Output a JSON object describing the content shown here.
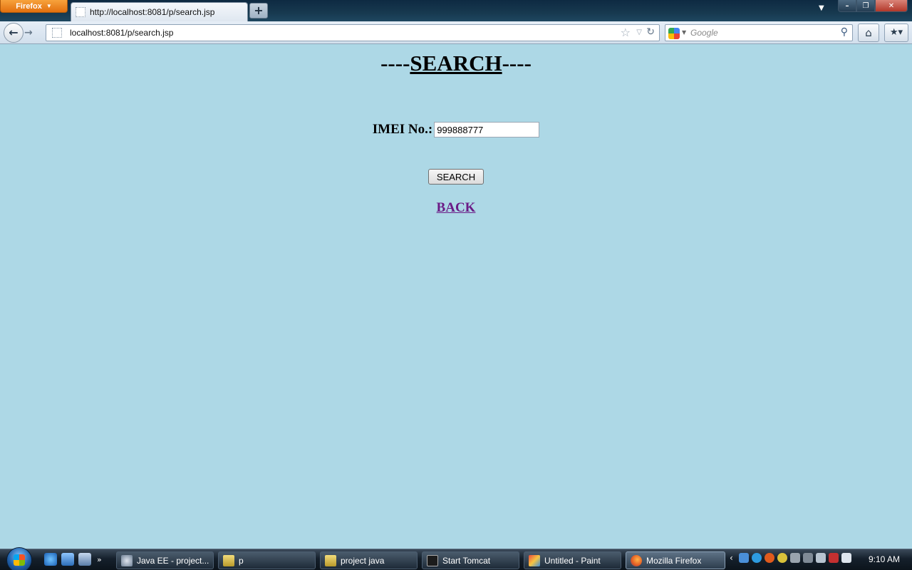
{
  "browser": {
    "menu_label": "Firefox",
    "tab_title": "http://localhost:8081/p/search.jsp",
    "new_tab_label": "+",
    "url": "localhost:8081/p/search.jsp",
    "search_placeholder": "Google"
  },
  "page": {
    "heading_prefix": "----",
    "heading_word": "SEARCH",
    "heading_suffix": "----",
    "imei_label": "IMEI No.:",
    "imei_value": "999888777",
    "search_button": "SEARCH",
    "back_link": "BACK"
  },
  "taskbar": {
    "tasks": [
      {
        "label": "Java EE - project...",
        "icon": "eclipse-icon"
      },
      {
        "label": "p",
        "icon": "folder-icon"
      },
      {
        "label": "project java",
        "icon": "folder-icon"
      },
      {
        "label": "Start Tomcat",
        "icon": "console-icon"
      },
      {
        "label": "Untitled - Paint",
        "icon": "paint-icon"
      },
      {
        "label": "Mozilla Firefox",
        "icon": "firefox-icon"
      }
    ],
    "clock": "9:10 AM"
  },
  "colors": {
    "page_background": "#add8e6",
    "visited_link": "#6b1b86"
  }
}
